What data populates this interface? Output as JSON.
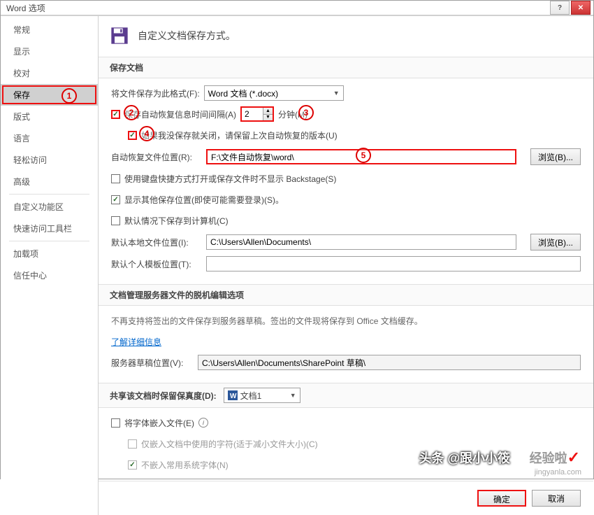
{
  "window_title": "Word 选项",
  "sidebar": {
    "items": [
      {
        "label": "常规"
      },
      {
        "label": "显示"
      },
      {
        "label": "校对"
      },
      {
        "label": "保存",
        "active": true
      },
      {
        "label": "版式"
      },
      {
        "label": "语言"
      },
      {
        "label": "轻松访问"
      },
      {
        "label": "高级"
      },
      {
        "sep": true
      },
      {
        "label": "自定义功能区"
      },
      {
        "label": "快速访问工具栏"
      },
      {
        "sep": true
      },
      {
        "label": "加载项"
      },
      {
        "label": "信任中心"
      }
    ]
  },
  "header": {
    "title": "自定义文档保存方式。"
  },
  "save": {
    "section_title": "保存文档",
    "format_label": "将文件保存为此格式(F):",
    "format_value": "Word 文档 (*.docx)",
    "autorecover_label": "保存自动恢复信息时间间隔(A)",
    "autorecover_value": "2",
    "minutes_label": "分钟(M)",
    "keep_last_label": "如果我没保存就关闭，请保留上次自动恢复的版本(U)",
    "autorecover_loc_label": "自动恢复文件位置(R):",
    "autorecover_loc_value": "F:\\文件自动恢复\\word\\",
    "browse_label": "浏览(B)...",
    "backstage_label": "使用键盘快捷方式打开或保存文件时不显示 Backstage(S)",
    "show_other_label": "显示其他保存位置(即使可能需要登录)(S)。",
    "save_local_label": "默认情况下保存到计算机(C)",
    "default_loc_label": "默认本地文件位置(I):",
    "default_loc_value": "C:\\Users\\Allen\\Documents\\",
    "template_loc_label": "默认个人模板位置(T):",
    "template_loc_value": ""
  },
  "server": {
    "section_title": "文档管理服务器文件的脱机编辑选项",
    "note": "不再支持将签出的文件保存到服务器草稿。签出的文件现将保存到 Office 文档缓存。",
    "learn_more": "了解详细信息",
    "draft_label": "服务器草稿位置(V):",
    "draft_value": "C:\\Users\\Allen\\Documents\\SharePoint 草稿\\"
  },
  "share": {
    "section_title_prefix": "共享该文档时保留保真度(D):",
    "doc_name": "文档1",
    "embed_fonts_label": "将字体嵌入文件(E)",
    "embed_used_label": "仅嵌入文档中使用的字符(适于减小文件大小)(C)",
    "no_sys_fonts_label": "不嵌入常用系统字体(N)"
  },
  "footer": {
    "ok": "确定",
    "cancel": "取消"
  },
  "annotations": {
    "n1": "1",
    "n2": "2",
    "n3": "3",
    "n4": "4",
    "n5": "5"
  },
  "watermark": {
    "left": "头条 @跟小小筱",
    "right": "经验啦",
    "domain": "jingyanla.com"
  }
}
